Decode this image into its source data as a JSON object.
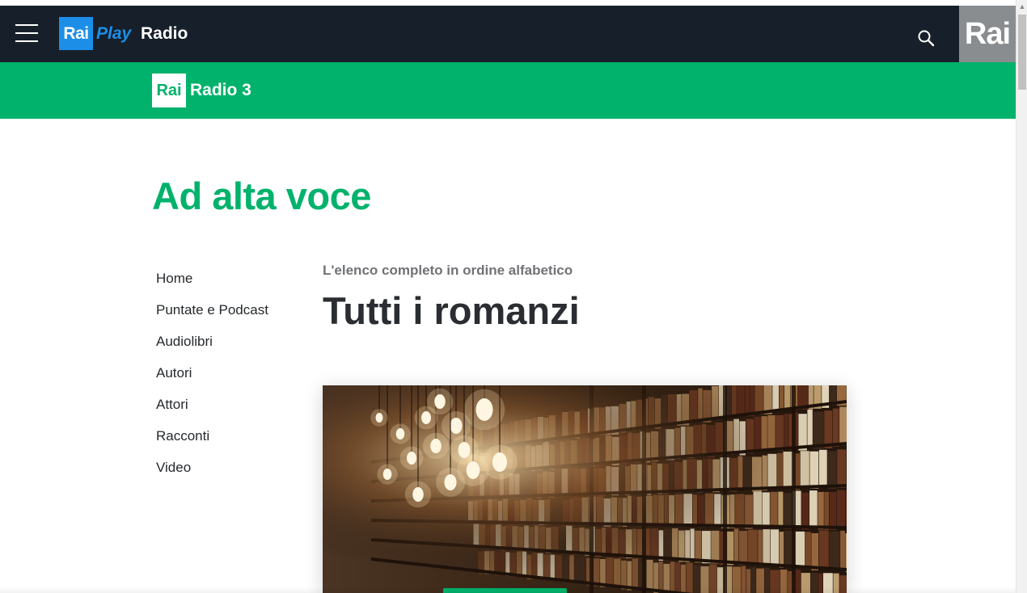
{
  "header": {
    "logo_rai": "Rai",
    "logo_play": "Play",
    "logo_radio": "Radio",
    "corner_logo": "Rai",
    "menu_icon": "hamburger-menu-icon",
    "search_icon": "search-icon"
  },
  "channel": {
    "logo_rai": "Rai",
    "name": "Radio 3",
    "color": "#00b26b"
  },
  "page": {
    "title": "Ad alta voce"
  },
  "sidebar": {
    "items": [
      {
        "label": "Home"
      },
      {
        "label": "Puntate e Podcast"
      },
      {
        "label": "Audiolibri"
      },
      {
        "label": "Autori"
      },
      {
        "label": "Attori"
      },
      {
        "label": "Racconti"
      },
      {
        "label": "Video"
      }
    ]
  },
  "main": {
    "subtitle": "L'elenco completo in ordine alfabetico",
    "heading": "Tutti i romanzi"
  },
  "colors": {
    "topbar": "#17202a",
    "brand_blue": "#1c8ee8",
    "accent_green": "#00b26b"
  }
}
